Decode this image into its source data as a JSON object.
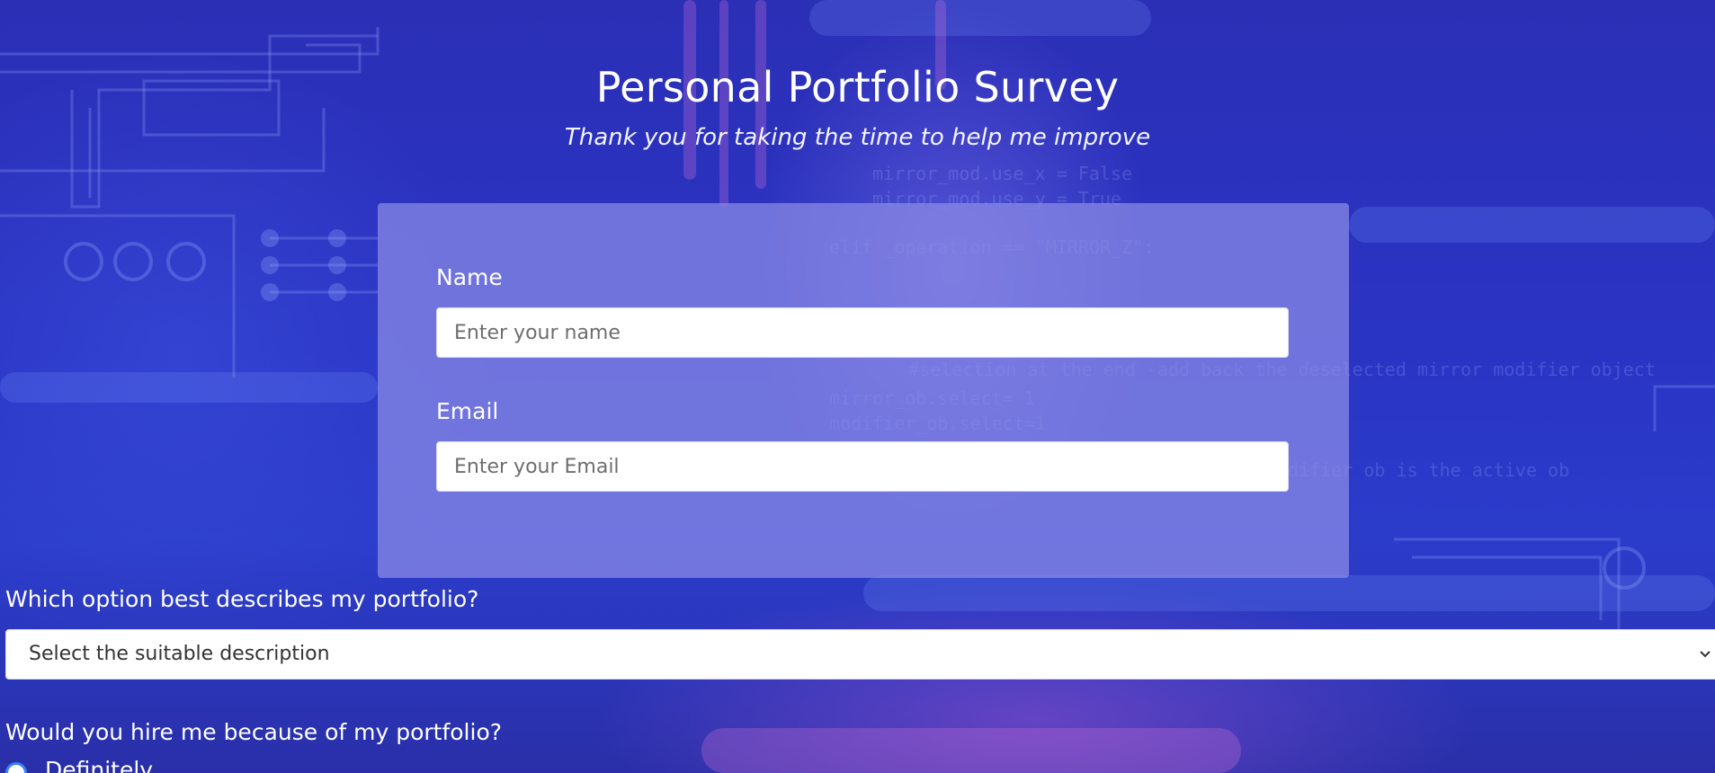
{
  "header": {
    "title": "Personal Portfolio Survey",
    "subtitle": "Thank you for taking the time to help me improve"
  },
  "form": {
    "name": {
      "label": "Name",
      "placeholder": "Enter your name",
      "value": ""
    },
    "email": {
      "label": "Email",
      "placeholder": "Enter your Email",
      "value": ""
    },
    "portfolio_description": {
      "question": "Which option best describes my portfolio?",
      "selected": "Select the suitable description",
      "icon": "chevron-down-icon"
    },
    "hire": {
      "question": "Would you hire me because of my portfolio?",
      "options": [
        "Definitely"
      ]
    }
  },
  "colors": {
    "background": "#2b34c0",
    "card": "#8c8ce6",
    "radio_accent": "#3b82f6",
    "text": "#ffffff"
  }
}
